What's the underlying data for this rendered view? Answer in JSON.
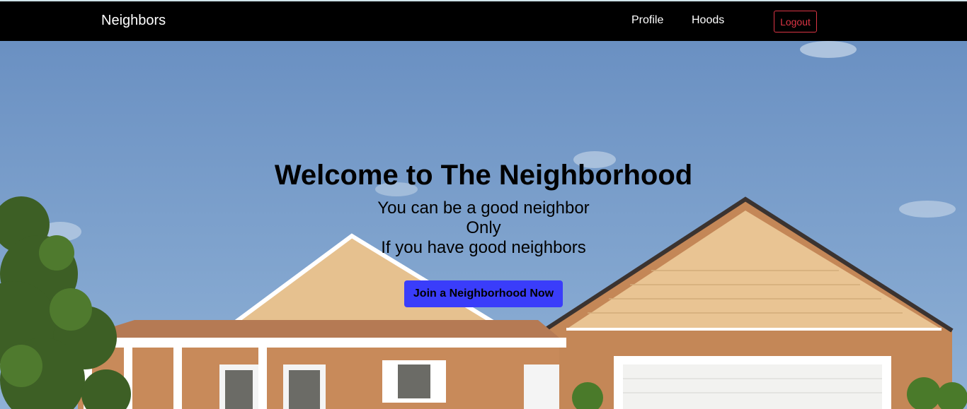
{
  "navbar": {
    "brand": "Neighbors",
    "links": [
      {
        "label": "Profile"
      },
      {
        "label": "Hoods"
      }
    ],
    "logout_label": "Logout"
  },
  "hero": {
    "title": "Welcome to The Neighborhood",
    "lines": [
      "You can be a good neighbor",
      "Only",
      "If you have good neighbors"
    ],
    "cta_label": "Join a Neighborhood Now"
  },
  "colors": {
    "navbar_bg": "#000000",
    "logout_accent": "#dc3545",
    "cta_bg": "#3a3dfa",
    "sky": "#6f95c4"
  },
  "background_image": "house-photo"
}
